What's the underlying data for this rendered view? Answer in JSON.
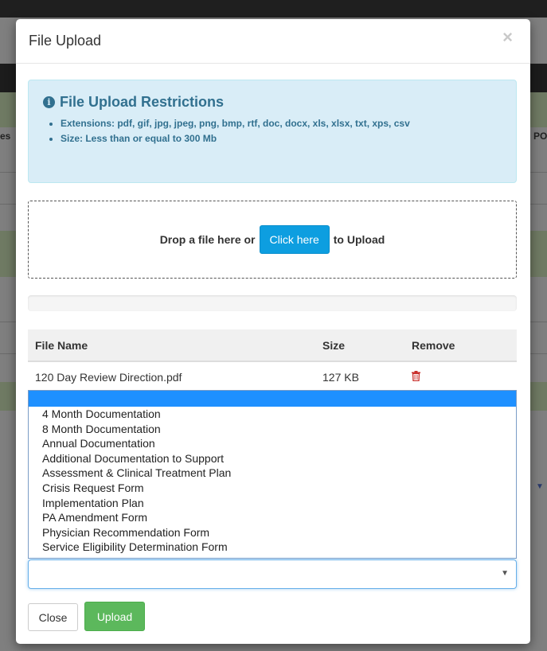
{
  "modal": {
    "title": "File Upload",
    "close_icon": "×"
  },
  "restrictions": {
    "title": "File Upload Restrictions",
    "items": [
      "Extensions: pdf, gif, jpg, jpeg, png, bmp, rtf, doc, docx, xls, xlsx, txt, xps, csv",
      "Size: Less than or equal to 300 Mb"
    ]
  },
  "dropzone": {
    "prefix": "Drop a file here or",
    "button_label": "Click here",
    "suffix": "to Upload"
  },
  "table": {
    "headers": [
      "File Name",
      "Size",
      "Remove"
    ],
    "rows": [
      {
        "name": "120 Day Review Direction.pdf",
        "size": "127 KB"
      }
    ]
  },
  "document_type_options": [
    "4 Month Documentation",
    "8 Month Documentation",
    "Annual Documentation",
    "Additional Documentation to Support",
    "Assessment & Clinical Treatment Plan",
    "Crisis Request Form",
    "Implementation Plan",
    "PA Amendment Form",
    "Physician Recommendation Form",
    "Service Eligibility Determination Form"
  ],
  "select": {
    "value": ""
  },
  "footer": {
    "close_label": "Close",
    "upload_label": "Upload"
  },
  "background": {
    "left_fragment": "es",
    "right_fragment": "PO"
  },
  "colors": {
    "primary": "#0d9ee0",
    "success": "#5cb85c",
    "info_bg": "#d9edf7",
    "info_text": "#31708f",
    "danger": "#c9302c",
    "highlight": "#1e90ff"
  }
}
